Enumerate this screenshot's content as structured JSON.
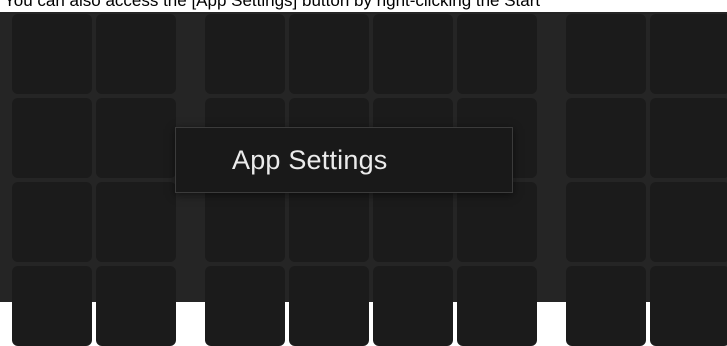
{
  "instruction": {
    "text": "You can also access the [App Settings] button by right-clicking the Start"
  },
  "pad_grid": {
    "rows": 4,
    "cols": 8,
    "color_panel": "#252525",
    "color_pad": "#1b1b1b"
  },
  "context_menu": {
    "items": [
      {
        "label": "App Settings"
      }
    ],
    "background": "#191919",
    "border": "#3b3b3b",
    "text_color": "#ebebeb"
  }
}
